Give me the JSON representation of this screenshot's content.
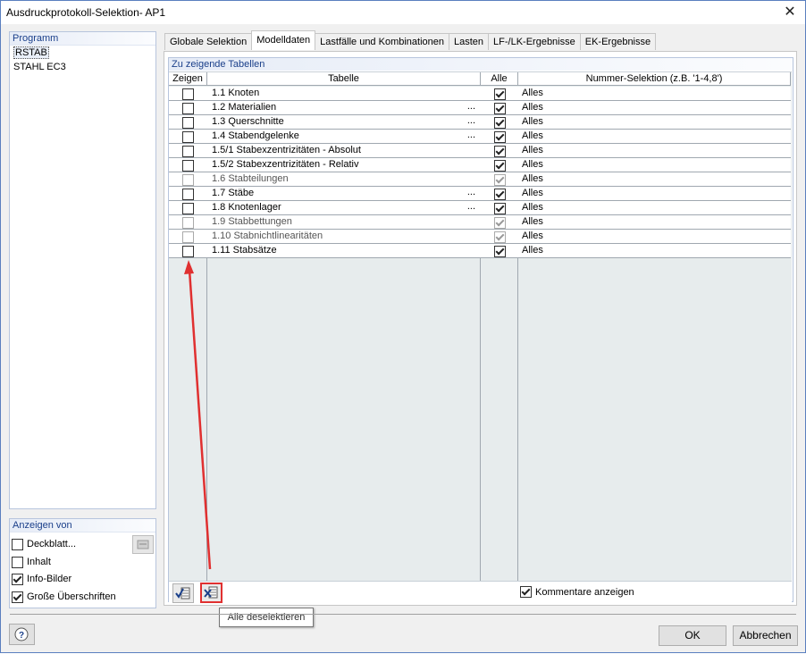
{
  "window": {
    "title": "Ausdruckprotokoll-Selektion- AP1"
  },
  "program_panel": {
    "heading": "Programm",
    "items": [
      {
        "label": "RSTAB",
        "selected": true
      },
      {
        "label": "STAHL EC3",
        "selected": false
      }
    ]
  },
  "show_panel": {
    "heading": "Anzeigen von",
    "options": [
      {
        "label": "Deckblatt...",
        "checked": false
      },
      {
        "label": "Inhalt",
        "checked": false
      },
      {
        "label": "Info-Bilder",
        "checked": true
      },
      {
        "label": "Große Überschriften",
        "checked": true
      }
    ]
  },
  "tabs": [
    {
      "label": "Globale Selektion",
      "active": false
    },
    {
      "label": "Modelldaten",
      "active": true
    },
    {
      "label": "Lastfälle und Kombinationen",
      "active": false
    },
    {
      "label": "Lasten",
      "active": false
    },
    {
      "label": "LF-/LK-Ergebnisse",
      "active": false
    },
    {
      "label": "EK-Ergebnisse",
      "active": false
    }
  ],
  "tables_group": {
    "heading": "Zu zeigende Tabellen",
    "columns": {
      "show": "Zeigen",
      "table": "Tabelle",
      "all": "Alle",
      "selection": "Nummer-Selektion (z.B. '1-4,8')"
    },
    "rows": [
      {
        "table": "1.1 Knoten",
        "has_dots": false,
        "enabled": true,
        "show": false,
        "all": true,
        "selection": "Alles"
      },
      {
        "table": "1.2 Materialien",
        "has_dots": true,
        "enabled": true,
        "show": false,
        "all": true,
        "selection": "Alles"
      },
      {
        "table": "1.3 Querschnitte",
        "has_dots": true,
        "enabled": true,
        "show": false,
        "all": true,
        "selection": "Alles"
      },
      {
        "table": "1.4 Stabendgelenke",
        "has_dots": true,
        "enabled": true,
        "show": false,
        "all": true,
        "selection": "Alles"
      },
      {
        "table": "1.5/1 Stabexzentrizitäten - Absolut",
        "has_dots": false,
        "enabled": true,
        "show": false,
        "all": true,
        "selection": "Alles"
      },
      {
        "table": "1.5/2 Stabexzentrizitäten - Relativ",
        "has_dots": false,
        "enabled": true,
        "show": false,
        "all": true,
        "selection": "Alles"
      },
      {
        "table": "1.6 Stabteilungen",
        "has_dots": false,
        "enabled": false,
        "show": false,
        "all": true,
        "selection": "Alles"
      },
      {
        "table": "1.7 Stäbe",
        "has_dots": true,
        "enabled": true,
        "show": false,
        "all": true,
        "selection": "Alles"
      },
      {
        "table": "1.8 Knotenlager",
        "has_dots": true,
        "enabled": true,
        "show": false,
        "all": true,
        "selection": "Alles"
      },
      {
        "table": "1.9 Stabbettungen",
        "has_dots": false,
        "enabled": false,
        "show": false,
        "all": true,
        "selection": "Alles"
      },
      {
        "table": "1.10 Stabnichtlinearitäten",
        "has_dots": false,
        "enabled": false,
        "show": false,
        "all": true,
        "selection": "Alles"
      },
      {
        "table": "1.11 Stabsätze",
        "has_dots": false,
        "enabled": true,
        "show": false,
        "all": true,
        "selection": "Alles"
      }
    ],
    "dots_label": "...",
    "comments_label": "Kommentare anzeigen",
    "comments_checked": true
  },
  "tooltip": "Alle deselektieren",
  "footer": {
    "ok": "OK",
    "cancel": "Abbrechen"
  },
  "colors": {
    "accent_red": "#e03030",
    "header_blue": "#1a3f8a"
  }
}
